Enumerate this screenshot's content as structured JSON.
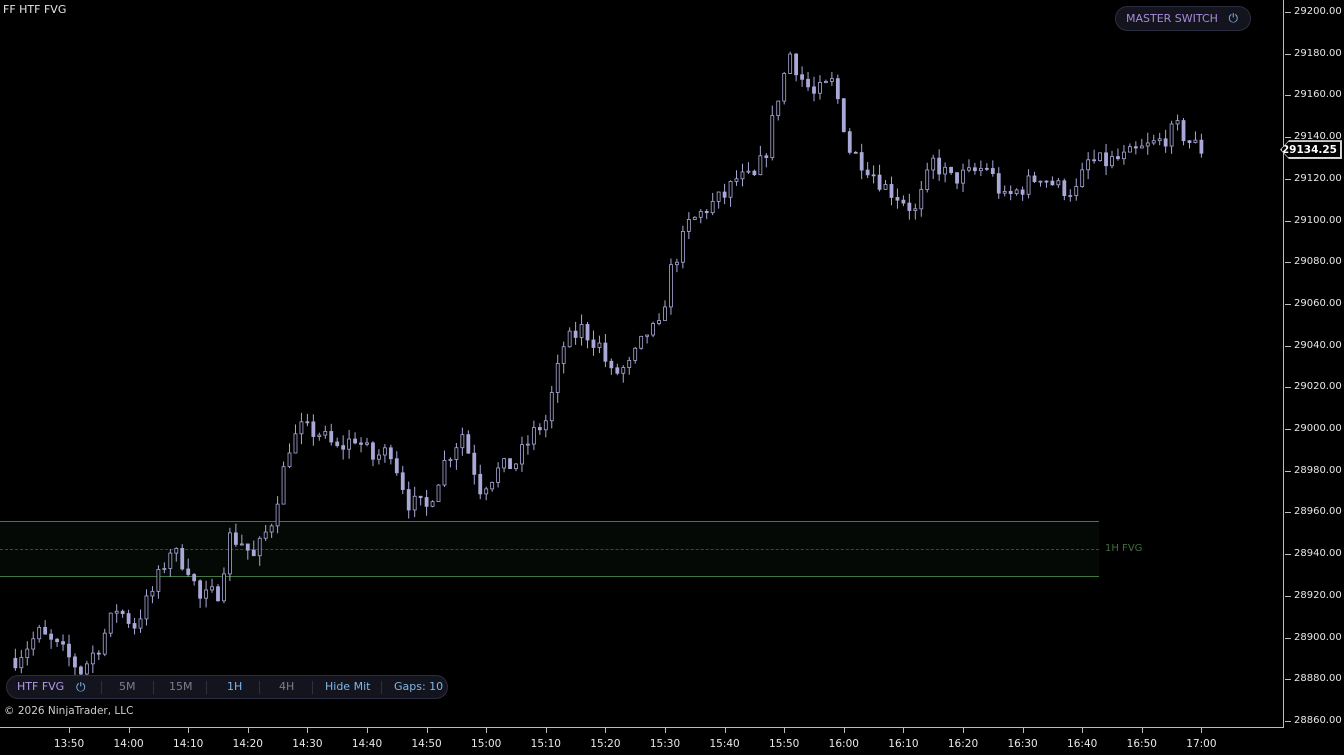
{
  "chart_title": "FF HTF FVG",
  "copyright": "© 2026 NinjaTrader, LLC",
  "master_switch": {
    "label": "MASTER SWITCH",
    "icon": "power-icon",
    "color": "#a78bdb"
  },
  "toolbar": {
    "htf_label": "HTF FVG",
    "power_icon": "power-icon",
    "tf_5m": "5M",
    "tf_15m": "15M",
    "tf_1h": "1H",
    "tf_4h": "4H",
    "hide_mit": "Hide Mit",
    "gaps": "Gaps: 10"
  },
  "fvg": {
    "label": "1H FVG",
    "top": 28956,
    "bottom": 28929,
    "color": "#3f7a3f"
  },
  "current_price": "29134.25",
  "price_axis": [
    "29200.00",
    "29180.00",
    "29160.00",
    "29140.00",
    "29120.00",
    "29100.00",
    "29080.00",
    "29060.00",
    "29040.00",
    "29020.00",
    "29000.00",
    "28980.00",
    "28960.00",
    "28940.00",
    "28920.00",
    "28900.00",
    "28880.00",
    "28860.00"
  ],
  "time_axis": [
    "13:50",
    "14:00",
    "14:10",
    "14:20",
    "14:30",
    "14:40",
    "14:50",
    "15:00",
    "15:10",
    "15:20",
    "15:30",
    "15:40",
    "15:50",
    "16:00",
    "16:10",
    "16:20",
    "16:30",
    "16:40",
    "16:50",
    "17:00"
  ],
  "chart_data": {
    "type": "candlestick",
    "ylim": [
      28860,
      29200
    ],
    "candle_color": "#a9a9d8",
    "path": [
      [
        "13:41",
        28890
      ],
      [
        "13:45",
        28902
      ],
      [
        "13:49",
        28893
      ],
      [
        "13:52",
        28884
      ],
      [
        "13:55",
        28896
      ],
      [
        "13:58",
        28914
      ],
      [
        "14:01",
        28906
      ],
      [
        "14:04",
        28922
      ],
      [
        "14:07",
        28942
      ],
      [
        "14:10",
        28934
      ],
      [
        "14:12",
        28918
      ],
      [
        "14:15",
        28922
      ],
      [
        "14:17",
        28948
      ],
      [
        "14:19",
        28946
      ],
      [
        "14:21",
        28938
      ],
      [
        "14:24",
        28956
      ],
      [
        "14:27",
        28992
      ],
      [
        "14:29",
        29000
      ],
      [
        "14:32",
        28998
      ],
      [
        "14:35",
        28990
      ],
      [
        "14:38",
        28996
      ],
      [
        "14:41",
        28986
      ],
      [
        "14:44",
        28990
      ],
      [
        "14:47",
        28965
      ],
      [
        "14:50",
        28962
      ],
      [
        "14:53",
        28984
      ],
      [
        "14:56",
        28998
      ],
      [
        "14:59",
        28972
      ],
      [
        "15:02",
        28980
      ],
      [
        "15:05",
        28984
      ],
      [
        "15:08",
        28998
      ],
      [
        "15:10",
        29004
      ],
      [
        "15:13",
        29040
      ],
      [
        "15:16",
        29048
      ],
      [
        "15:19",
        29040
      ],
      [
        "15:21",
        29026
      ],
      [
        "15:24",
        29030
      ],
      [
        "15:27",
        29046
      ],
      [
        "15:29",
        29048
      ],
      [
        "15:31",
        29076
      ],
      [
        "15:34",
        29098
      ],
      [
        "15:37",
        29106
      ],
      [
        "15:40",
        29112
      ],
      [
        "15:42",
        29120
      ],
      [
        "15:45",
        29120
      ],
      [
        "15:47",
        29134
      ],
      [
        "15:49",
        29160
      ],
      [
        "15:51",
        29180
      ],
      [
        "15:53",
        29168
      ],
      [
        "15:55",
        29160
      ],
      [
        "15:58",
        29166
      ],
      [
        "15:59",
        29158
      ],
      [
        "16:01",
        29134
      ],
      [
        "16:04",
        29126
      ],
      [
        "16:07",
        29116
      ],
      [
        "16:10",
        29110
      ],
      [
        "16:12",
        29104
      ],
      [
        "16:15",
        29128
      ],
      [
        "16:18",
        29120
      ],
      [
        "16:21",
        29122
      ],
      [
        "16:24",
        29126
      ],
      [
        "16:27",
        29110
      ],
      [
        "16:30",
        29116
      ],
      [
        "16:33",
        29122
      ],
      [
        "16:36",
        29116
      ],
      [
        "16:39",
        29114
      ],
      [
        "16:41",
        29128
      ],
      [
        "16:44",
        29128
      ],
      [
        "16:47",
        29130
      ],
      [
        "16:50",
        29134
      ],
      [
        "16:53",
        29138
      ],
      [
        "16:56",
        29144
      ],
      [
        "16:58",
        29138
      ],
      [
        "17:00",
        29134
      ]
    ]
  }
}
